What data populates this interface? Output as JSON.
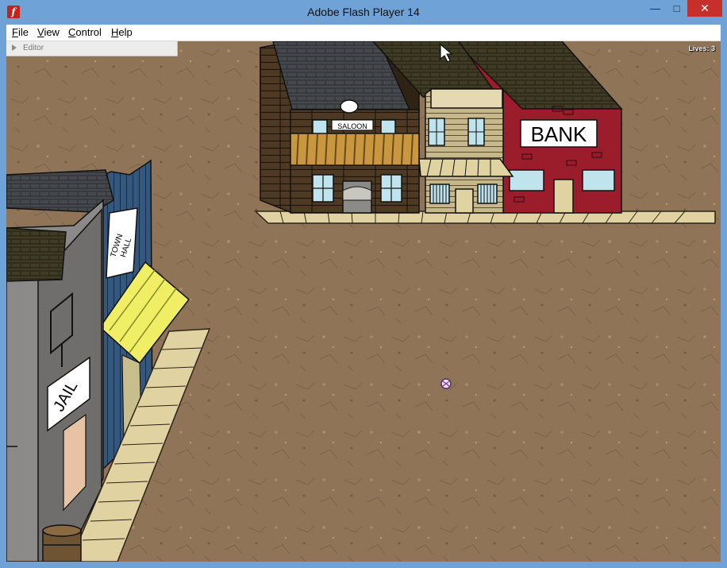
{
  "window": {
    "title": "Adobe Flash Player 14",
    "app_icon": "f",
    "minimize_icon": "—",
    "maximize_icon": "□",
    "close_icon": "✕"
  },
  "menu": {
    "items": [
      "File",
      "View",
      "Control",
      "Help"
    ]
  },
  "editor": {
    "label": "Editor"
  },
  "hud": {
    "lives": "Lives: 3"
  },
  "signs": {
    "saloon": "SALOON",
    "bank": "BANK",
    "town_hall_line1": "TOWN",
    "town_hall_line2": "HALL",
    "jail": "JAIL"
  },
  "colors": {
    "ground": "#8f7458",
    "bank_red": "#9b1d2c",
    "town_hall_blue": "#35577c",
    "saloon_brown": "#4e3a24",
    "awning_yellow": "#efee64",
    "boardwalk": "#e1d2a2"
  }
}
